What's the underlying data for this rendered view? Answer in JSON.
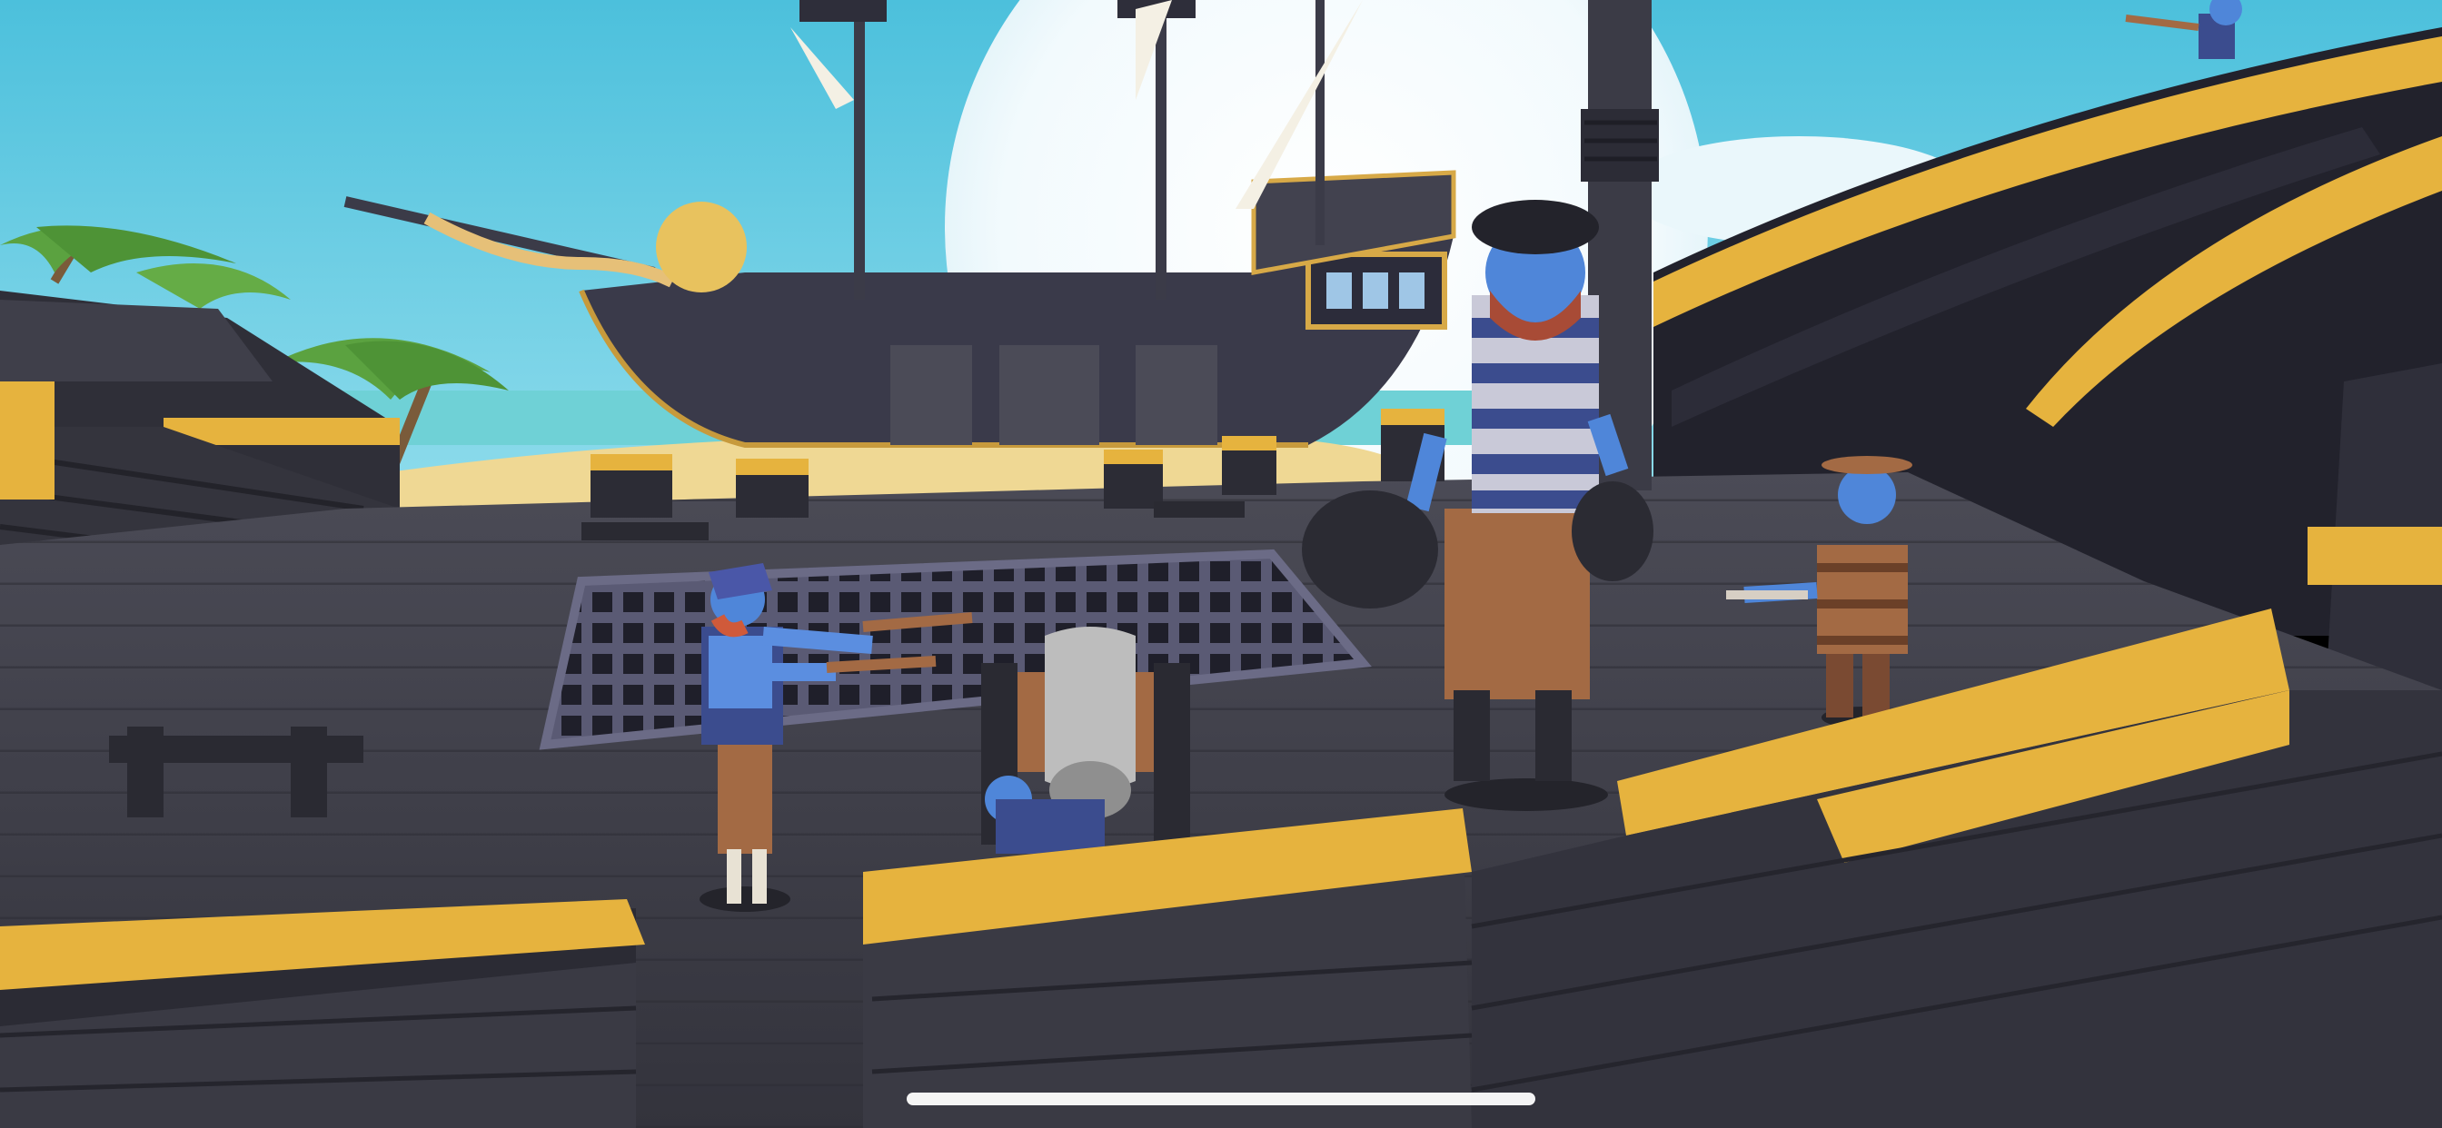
{
  "screen": {
    "description_visible_text": "",
    "hud": {
      "home_indicator": true
    }
  },
  "palette": {
    "sky": "#5cc9e2",
    "sun_glow": "#e9f6fb",
    "deck_dark": "#35353f",
    "deck_mid": "#4a4a55",
    "trim_gold": "#e6b33e",
    "sand": "#efd894",
    "hull": "#2e3040",
    "unit_skin_blue": "#4f86d9",
    "unit_pants_brown": "#a36a44",
    "stripe_light": "#c9c9d8",
    "stripe_dark": "#3b4c8e"
  },
  "icons": {
    "home_indicator": "home-indicator-bar"
  }
}
